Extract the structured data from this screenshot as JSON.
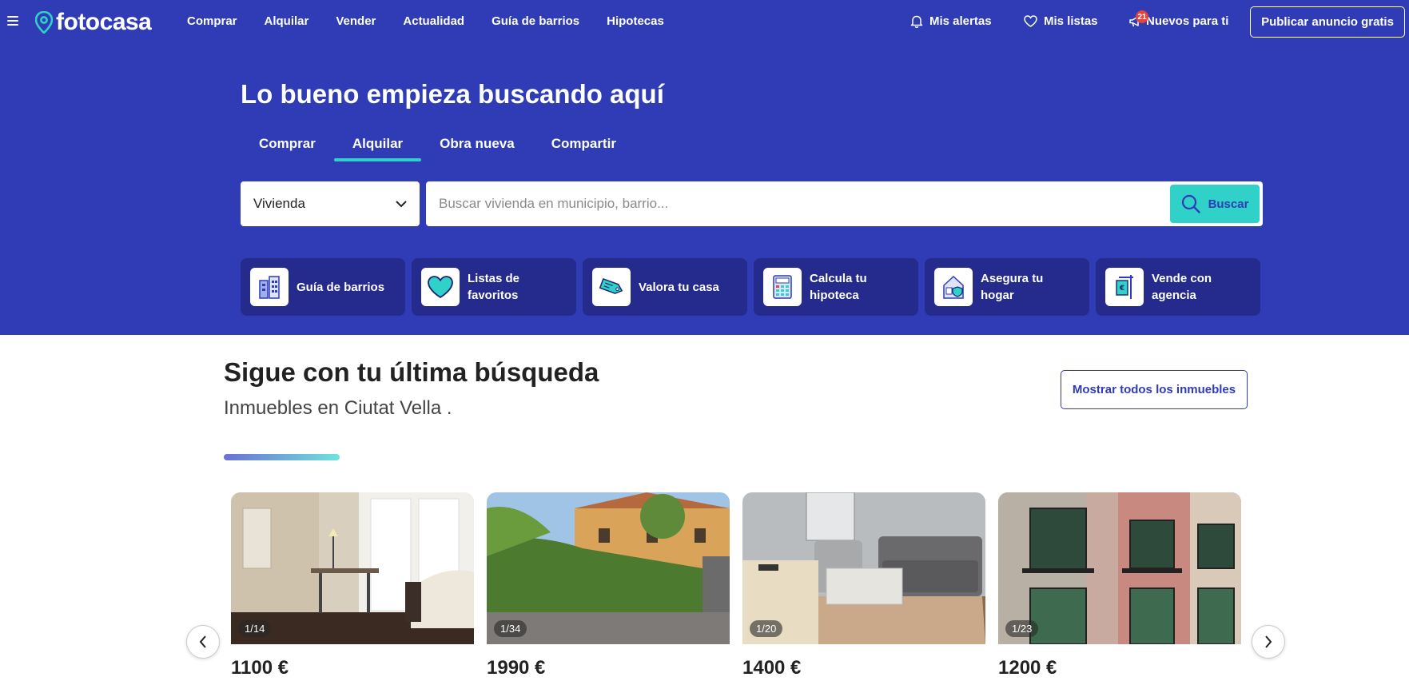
{
  "header": {
    "logo": "fotocasa",
    "nav": [
      "Comprar",
      "Alquilar",
      "Vender",
      "Actualidad",
      "Guía de barrios",
      "Hipotecas"
    ],
    "alerts": "Mis alertas",
    "lists": "Mis listas",
    "news": "Nuevos para ti",
    "news_badge": "21",
    "publish": "Publicar anuncio gratis"
  },
  "hero": {
    "title": "Lo bueno empieza buscando aquí",
    "tabs": [
      "Comprar",
      "Alquilar",
      "Obra nueva",
      "Compartir"
    ],
    "active_tab": "Alquilar",
    "select_value": "Vivienda",
    "search_placeholder": "Buscar vivienda en municipio, barrio...",
    "search_button": "Buscar",
    "shortcuts": [
      {
        "label": "Guía de barrios",
        "icon": "buildings-icon"
      },
      {
        "label": "Listas de favoritos",
        "icon": "heart-icon"
      },
      {
        "label": "Valora tu casa",
        "icon": "price-tag-icon"
      },
      {
        "label": "Calcula tu hipoteca",
        "icon": "calculator-icon"
      },
      {
        "label": "Asegura tu hogar",
        "icon": "house-shield-icon"
      },
      {
        "label": "Vende con agencia",
        "icon": "sale-sign-icon"
      }
    ]
  },
  "section": {
    "title": "Sigue con tu última búsqueda",
    "subtitle": "Inmuebles en Ciutat Vella .",
    "show_all": "Mostrar todos los inmuebles"
  },
  "listings": [
    {
      "counter": "1/14",
      "price": "1100 €"
    },
    {
      "counter": "1/34",
      "price": "1990 €"
    },
    {
      "counter": "1/20",
      "price": "1400 €"
    },
    {
      "counter": "1/23",
      "price": "1200 €"
    }
  ],
  "colors": {
    "brand": "#2f3cb5",
    "accent": "#2fd1c8",
    "shortcut_bg": "#242b8c"
  }
}
